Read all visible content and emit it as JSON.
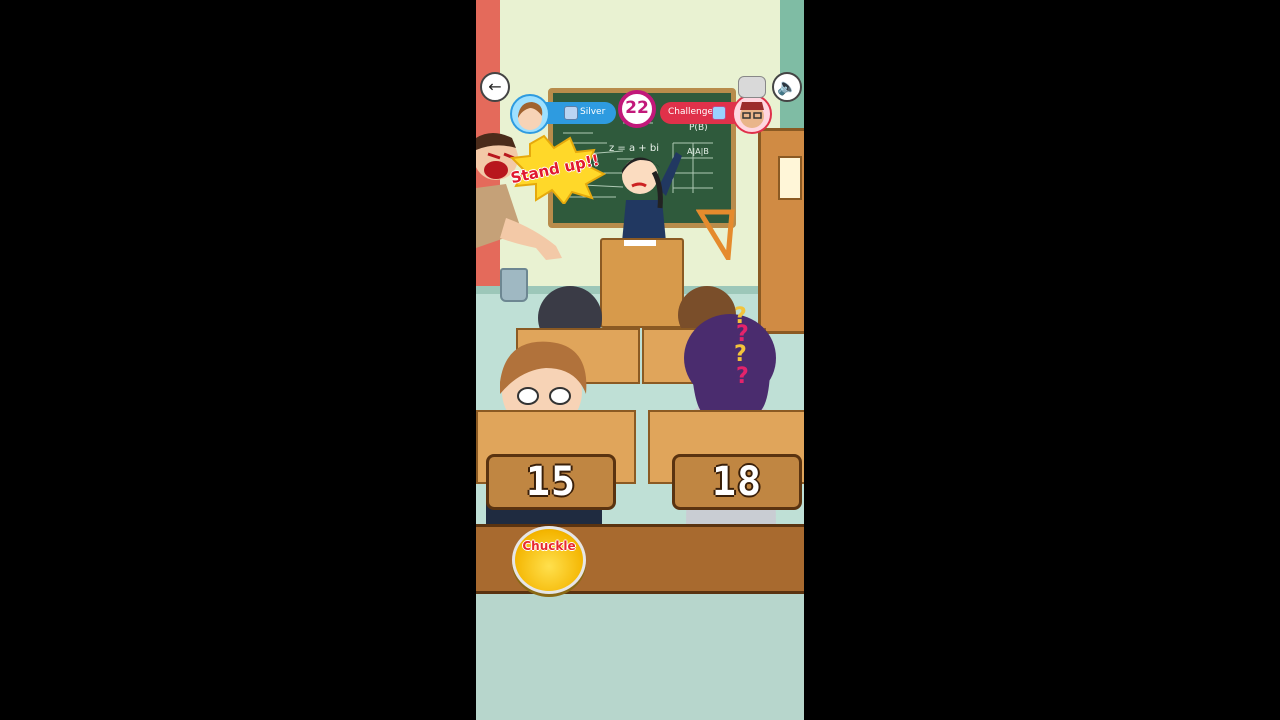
{
  "hud": {
    "timer": "22",
    "player_rank": "Silver",
    "opponent_rank": "Challenger",
    "colors": {
      "player": "#2e9be0",
      "opponent": "#e0314a",
      "timer_ring": "#c2187a"
    }
  },
  "speech_bubble": "Stand up!!",
  "chalkboard": {
    "header": "P(B)",
    "equation": "z = a + bi",
    "table_header": "A|A|B"
  },
  "scores": {
    "player": "15",
    "opponent": "18"
  },
  "chuckle_button": "Chuckle",
  "icons": {
    "back": "back-arrow-icon",
    "sound": "speaker-icon"
  }
}
